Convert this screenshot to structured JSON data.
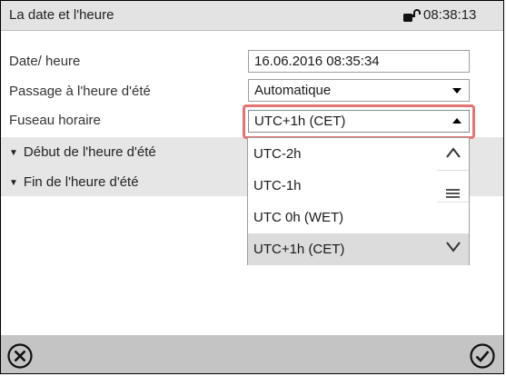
{
  "header": {
    "title": "La date et l'heure",
    "time": "08:38:13",
    "lock_icon": "lock-icon"
  },
  "fields": {
    "date_label": "Date/ heure",
    "date_value": "16.06.2016 08:35:34",
    "dst_label": "Passage à l'heure d'été",
    "dst_value": "Automatique",
    "tz_label": "Fuseau horaire",
    "tz_value": "UTC+1h (CET)"
  },
  "sections": {
    "start_label": "Début de l'heure d'été",
    "end_label": "Fin de l'heure d'été"
  },
  "timezone_dropdown": {
    "options": [
      "UTC-2h",
      "UTC-1h",
      "UTC 0h (WET)",
      "UTC+1h (CET)"
    ],
    "selected": "UTC+1h (CET)"
  },
  "footer": {
    "cancel_icon": "cancel-icon",
    "confirm_icon": "confirm-icon"
  },
  "colors": {
    "titlebar": "#e3e3e3",
    "footer": "#c4c4c4",
    "highlight": "#e57373",
    "selected_option": "#dcdcdc"
  }
}
